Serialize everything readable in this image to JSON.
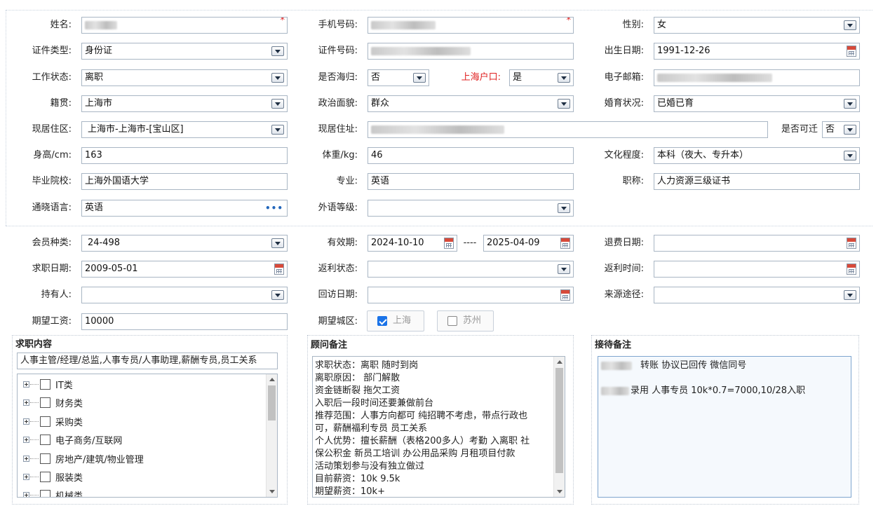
{
  "required_mark": "*",
  "basic": {
    "name": {
      "label": "姓名:",
      "value": ""
    },
    "phone": {
      "label": "手机号码:",
      "value": ""
    },
    "gender": {
      "label": "性别:",
      "value": "女"
    },
    "id_type": {
      "label": "证件类型:",
      "value": "身份证"
    },
    "id_number": {
      "label": "证件号码:",
      "value": ""
    },
    "birth": {
      "label": "出生日期:",
      "value": "1991-12-26"
    },
    "work_status": {
      "label": "工作状态:",
      "value": "离职"
    },
    "returnee": {
      "label": "是否海归:",
      "value": "否"
    },
    "shanghai_hukou": {
      "label": "上海户口:",
      "value": "是"
    },
    "email": {
      "label": "电子邮箱:",
      "value": ""
    },
    "native": {
      "label": "籍贯:",
      "value": "上海市"
    },
    "political": {
      "label": "政治面貌:",
      "value": "群众"
    },
    "marital": {
      "label": "婚育状况:",
      "value": "已婚已育"
    },
    "district": {
      "label": "现居住区:",
      "value": "上海市-上海市-[宝山区]"
    },
    "address": {
      "label": "现居住址:",
      "value": ""
    },
    "relocate": {
      "label": "是否可迁",
      "value": "否"
    },
    "height": {
      "label": "身高/cm:",
      "value": "163"
    },
    "weight": {
      "label": "体重/kg:",
      "value": "46"
    },
    "education": {
      "label": "文化程度:",
      "value": "本科（夜大、专升本）"
    },
    "school": {
      "label": "毕业院校:",
      "value": "上海外国语大学"
    },
    "major": {
      "label": "专业:",
      "value": "英语"
    },
    "title": {
      "label": "职称:",
      "value": "人力资源三级证书"
    },
    "language": {
      "label": "通晓语言:",
      "value": "英语",
      "more": "•••"
    },
    "lang_level": {
      "label": "外语等级:",
      "value": ""
    }
  },
  "member": {
    "type": {
      "label": "会员种类:",
      "value": "24-498"
    },
    "valid": {
      "label": "有效期:",
      "from": "2024-10-10",
      "sep": "----",
      "to": "2025-04-09"
    },
    "refund_date": {
      "label": "退费日期:",
      "value": ""
    },
    "job_date": {
      "label": "求职日期:",
      "value": "2009-05-01"
    },
    "rebate_status": {
      "label": "返利状态:",
      "value": ""
    },
    "rebate_time": {
      "label": "返利时间:",
      "value": ""
    },
    "holder": {
      "label": "持有人:",
      "value": ""
    },
    "visit_date": {
      "label": "回访日期:",
      "value": ""
    },
    "source": {
      "label": "来源途径:",
      "value": ""
    },
    "salary": {
      "label": "期望工资:",
      "value": "10000"
    },
    "city": {
      "label": "期望城区:",
      "options": [
        {
          "label": "上海",
          "checked": true
        },
        {
          "label": "苏州",
          "checked": false
        }
      ]
    }
  },
  "job_panel": {
    "title": "求职内容",
    "selected": "人事主管/经理/总监,人事专员/人事助理,薪酬专员,员工关系",
    "tree": [
      "IT类",
      "财务类",
      "采购类",
      "电子商务/互联网",
      "房地产/建筑/物业管理",
      "服装类",
      "机械类"
    ]
  },
  "advisor_panel": {
    "title": "顾问备注",
    "lines": [
      "求职状态：离职 随时到岗",
      "离职原因： 部门解散",
      " 资金链断裂 拖欠工资",
      " 入职后一段时间还要兼做前台",
      "推荐范围：人事方向都可  纯招聘不考虑，带点行政也",
      "可，薪酬福利专员 员工关系",
      "个人优势：擅长薪酬（表格200多人）考勤 入离职 社",
      "保公积金  新员工培训  办公用品采购 月租项目付款",
      "活动策划参与没有独立做过",
      "目前薪资：10k  9.5k",
      "期望薪资：10k+"
    ]
  },
  "reception_panel": {
    "title": "接待备注",
    "lines": [
      "转账 协议已回传  微信同号",
      "",
      "录用 人事专员  10k*0.7=7000,10/28入职"
    ]
  }
}
